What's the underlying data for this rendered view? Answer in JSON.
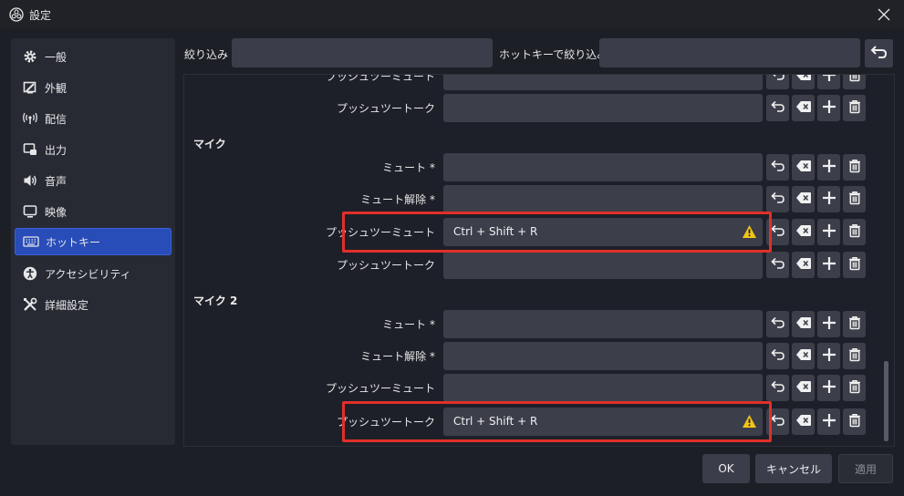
{
  "window": {
    "title": "設定"
  },
  "sidebar": {
    "items": [
      {
        "label": "一般",
        "icon": "gear-icon"
      },
      {
        "label": "外観",
        "icon": "appearance-icon"
      },
      {
        "label": "配信",
        "icon": "broadcast-icon"
      },
      {
        "label": "出力",
        "icon": "output-icon"
      },
      {
        "label": "音声",
        "icon": "speaker-icon"
      },
      {
        "label": "映像",
        "icon": "monitor-icon"
      },
      {
        "label": "ホットキー",
        "icon": "keyboard-icon",
        "active": true
      },
      {
        "label": "アクセシビリティ",
        "icon": "accessibility-icon"
      },
      {
        "label": "詳細設定",
        "icon": "tools-icon"
      }
    ]
  },
  "filter": {
    "label": "絞り込み",
    "value": "",
    "hotkey_label": "ホットキーで絞り込み",
    "hotkey_value": ""
  },
  "hotkeys": {
    "top_rows": [
      {
        "label": "プッシュツーミュート",
        "value": ""
      },
      {
        "label": "プッシュツートーク",
        "value": ""
      }
    ],
    "groups": [
      {
        "name": "マイク",
        "rows": [
          {
            "label": "ミュート *",
            "value": ""
          },
          {
            "label": "ミュート解除 *",
            "value": ""
          },
          {
            "label": "プッシュツーミュート",
            "value": "Ctrl + Shift + R",
            "warning": true,
            "highlighted": true
          },
          {
            "label": "プッシュツートーク",
            "value": ""
          }
        ]
      },
      {
        "name": "マイク 2",
        "rows": [
          {
            "label": "ミュート *",
            "value": ""
          },
          {
            "label": "ミュート解除 *",
            "value": ""
          },
          {
            "label": "プッシュツーミュート",
            "value": ""
          },
          {
            "label": "プッシュツートーク",
            "value": "Ctrl + Shift + R",
            "warning": true,
            "highlighted": true
          }
        ]
      }
    ]
  },
  "footer": {
    "ok": "OK",
    "cancel": "キャンセル",
    "apply": "適用"
  },
  "colors": {
    "accent": "#284cb8",
    "warning": "#f0c419",
    "highlight": "#e0302a",
    "field": "#3c3f4a",
    "background": "#1d1f26"
  }
}
